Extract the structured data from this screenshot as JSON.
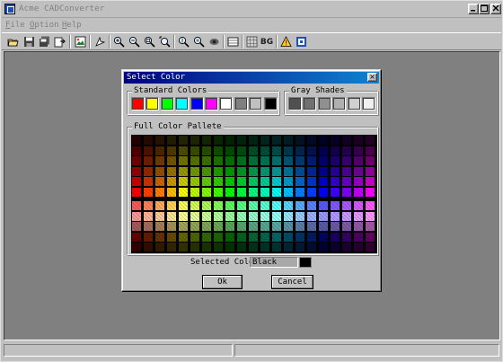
{
  "window": {
    "title": "Acme CADConverter"
  },
  "menu": [
    {
      "label": "File",
      "mnemonic": "F",
      "rest": "ile"
    },
    {
      "label": "Option",
      "mnemonic": "O",
      "rest": "ption"
    },
    {
      "label": "Help",
      "mnemonic": "H",
      "rest": "elp"
    }
  ],
  "toolbar": {
    "buttons": [
      "open-folder-icon",
      "save-icon",
      "save-all-icon",
      "export-icon",
      "convert-image-icon",
      "select-icon",
      "zoom-in-icon",
      "zoom-out-icon",
      "zoom-window-icon",
      "zoom-fit-icon",
      "zoom-realtime-icon",
      "pan-icon",
      "eye-icon",
      "layers-icon",
      "grid-icon",
      "warning-icon",
      "info-icon"
    ],
    "bg_label": "BG"
  },
  "dialog": {
    "title": "Select Color",
    "close_glyph": "×",
    "standard_colors_label": "Standard Colors",
    "gray_shades_label": "Gray Shades",
    "full_palette_label": "Full Color Pallete",
    "selected_color_label": "Selected Color",
    "selected_color_value": "Black",
    "selected_color_hex": "#000000",
    "ok_label": "Ok",
    "cancel_label": "Cancel"
  },
  "standard_colors": [
    "#ff0000",
    "#ffff00",
    "#00ff00",
    "#00ffff",
    "#0000ff",
    "#ff00ff",
    "#ffffff",
    "#808080",
    "#c0c0c0",
    "#000000"
  ],
  "gray_shades": [
    "#505050",
    "#707070",
    "#909090",
    "#b0b0b0",
    "#d0d0d0",
    "#f0f0f0"
  ],
  "palette": {
    "hues": [
      "#ff0000",
      "#ff4000",
      "#ff8000",
      "#ffbf00",
      "#ffff00",
      "#bfff00",
      "#80ff00",
      "#40ff00",
      "#00ff00",
      "#00ff40",
      "#00ff80",
      "#00ffbf",
      "#00ffff",
      "#00bfff",
      "#0080ff",
      "#0040ff",
      "#0000ff",
      "#4000ff",
      "#8000ff",
      "#bf00ff",
      "#ff00ff"
    ],
    "row_mix": [
      {
        "toward": "#000000",
        "amount": 0.85
      },
      {
        "toward": "#000000",
        "amount": 0.7
      },
      {
        "toward": "#000000",
        "amount": 0.55
      },
      {
        "toward": "#000000",
        "amount": 0.4
      },
      {
        "toward": "#000000",
        "amount": 0.2
      },
      {
        "toward": "#000000",
        "amount": 0.0
      },
      {
        "toward": "#ffffff",
        "amount": 0.35
      },
      {
        "toward": "#ffffff",
        "amount": 0.6
      },
      {
        "toward": "#808080",
        "amount": 0.7
      },
      {
        "toward": "#000000",
        "amount": 0.6
      },
      {
        "toward": "#000000",
        "amount": 0.8
      }
    ]
  }
}
